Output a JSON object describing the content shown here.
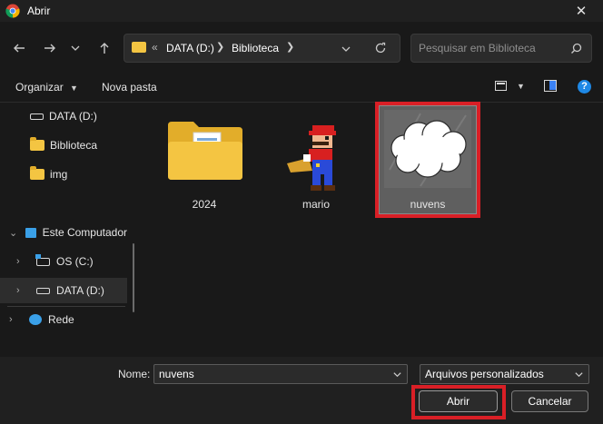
{
  "window": {
    "title": "Abrir",
    "app_icon": "chrome-icon",
    "close_icon": "close-icon"
  },
  "nav": {
    "back_icon": "arrow-left-icon",
    "forward_icon": "arrow-right-icon",
    "recent_icon": "chevron-down-icon",
    "up_icon": "arrow-up-icon",
    "refresh_icon": "refresh-icon"
  },
  "address": {
    "overflow": "«",
    "crumbs": [
      "DATA (D:)",
      "Biblioteca"
    ]
  },
  "search": {
    "placeholder": "Pesquisar em Biblioteca"
  },
  "toolbar": {
    "organize_label": "Organizar",
    "new_folder_label": "Nova pasta",
    "help_label": "?"
  },
  "sidebar": {
    "items": [
      {
        "label": "DATA (D:)",
        "icon": "drive-icon"
      },
      {
        "label": "Biblioteca",
        "icon": "folder-icon"
      },
      {
        "label": "img",
        "icon": "folder-icon"
      },
      {
        "label": "Este Computador",
        "icon": "computer-icon"
      },
      {
        "label": "OS (C:)",
        "icon": "windows-drive-icon"
      },
      {
        "label": "DATA (D:)",
        "icon": "drive-icon"
      },
      {
        "label": "Rede",
        "icon": "network-icon"
      }
    ]
  },
  "files": [
    {
      "name": "2024",
      "type": "folder"
    },
    {
      "name": "mario",
      "type": "image"
    },
    {
      "name": "nuvens",
      "type": "image",
      "selected": true
    }
  ],
  "footer": {
    "name_label": "Nome:",
    "name_value": "nuvens",
    "filter_value": "Arquivos personalizados",
    "open_label": "Abrir",
    "cancel_label": "Cancelar"
  },
  "colors": {
    "highlight": "#d91f26",
    "folder": "#f4c542",
    "help": "#1e88e5"
  }
}
